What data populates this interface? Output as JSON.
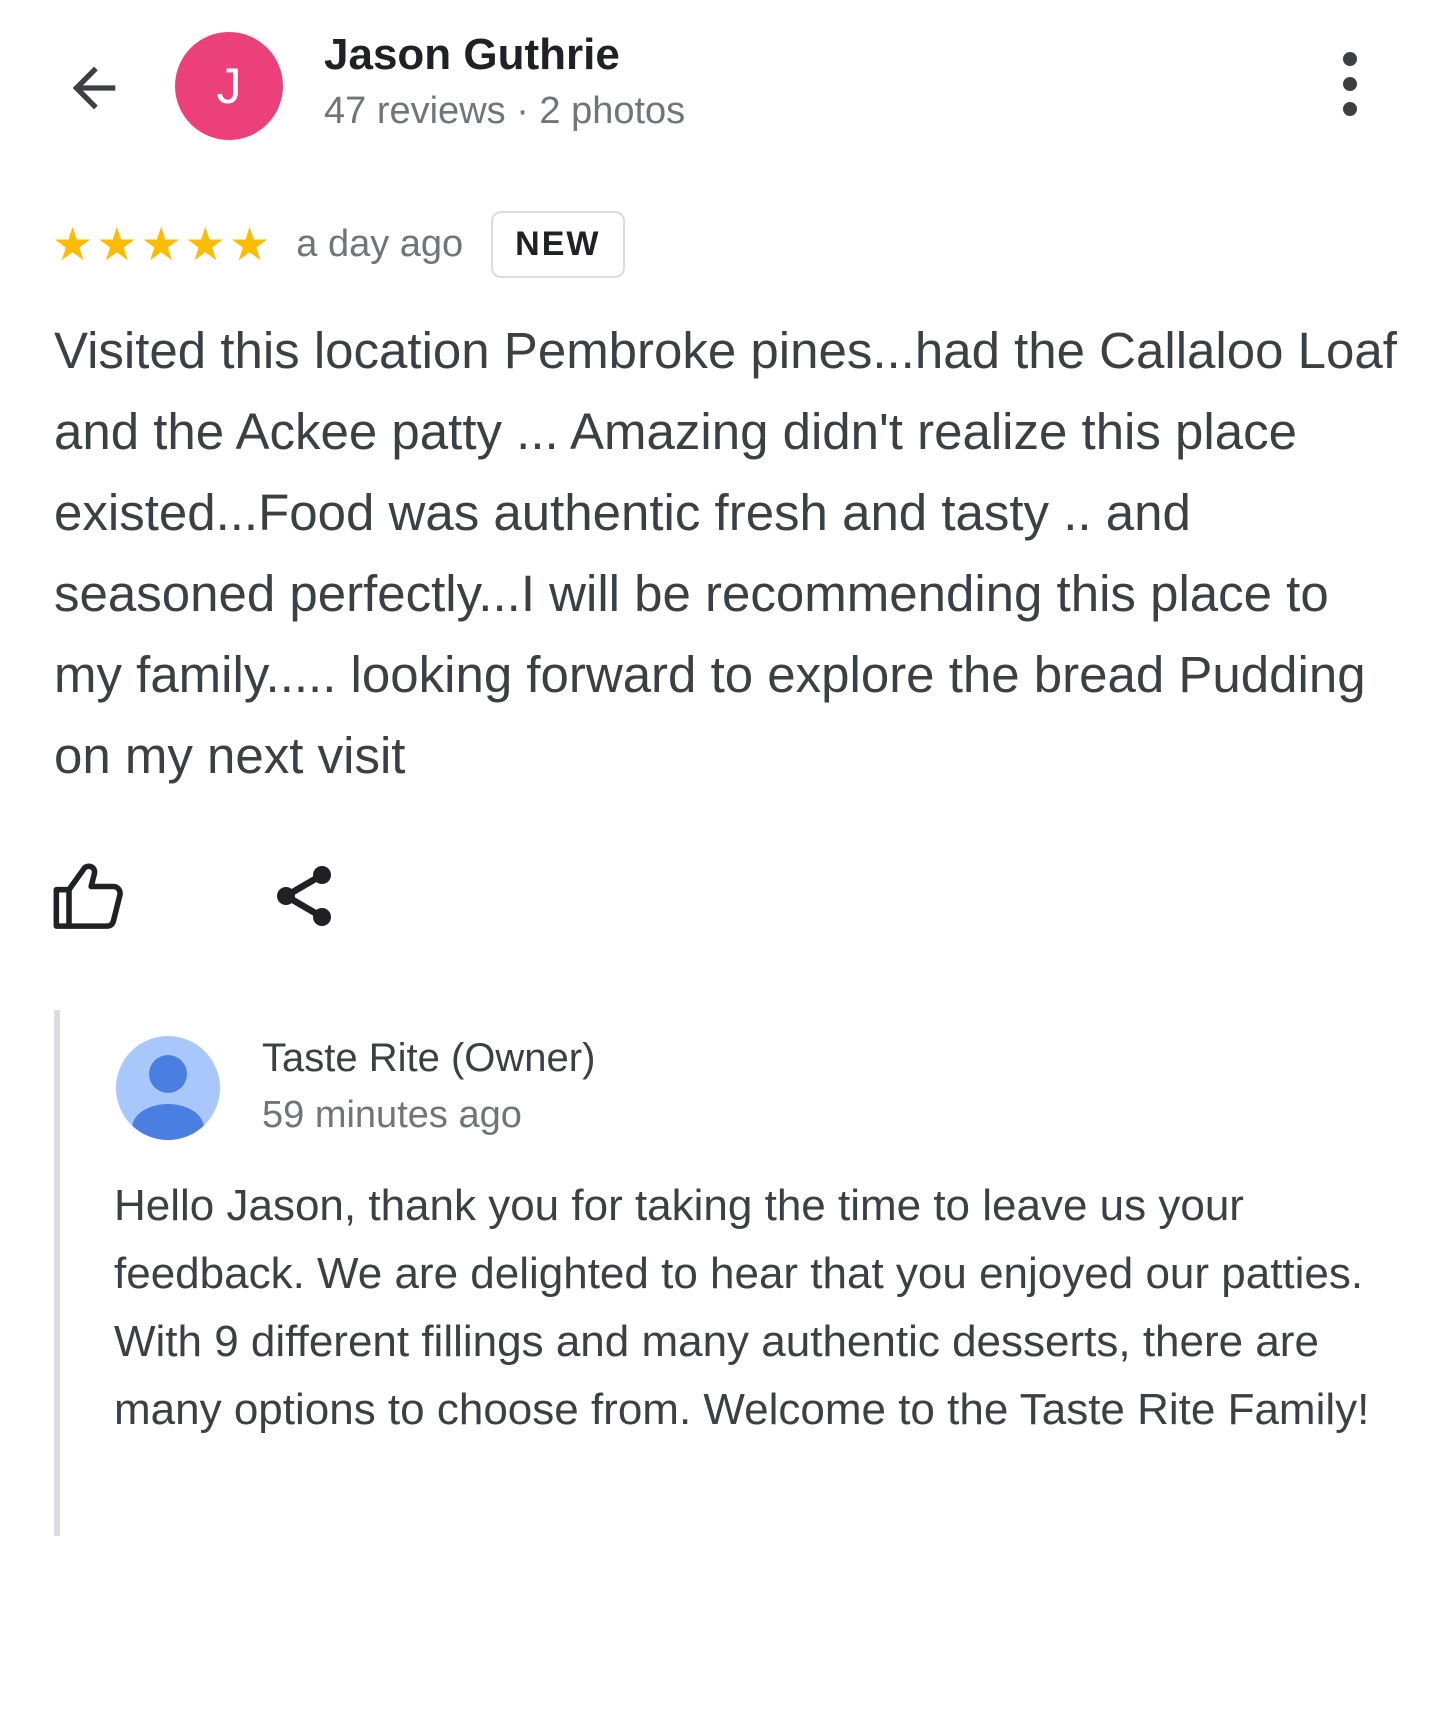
{
  "reviewer": {
    "initial": "J",
    "name": "Jason Guthrie",
    "meta": "47 reviews · 2 photos",
    "avatar_color": "#ec407a"
  },
  "review": {
    "rating": 5,
    "stars": "★★★★★",
    "date": "a day ago",
    "badge": "NEW",
    "text": "Visited this location Pembroke pines...had the Callaloo Loaf and the Ackee patty ... Amazing didn't realize this place existed...Food was authentic fresh and tasty .. and seasoned perfectly...I will be recommending this place to my family..... looking forward to explore the bread Pudding on my next visit"
  },
  "actions": {
    "like_icon": "thumb-up-icon",
    "share_icon": "share-icon"
  },
  "owner_reply": {
    "name": "Taste Rite (Owner)",
    "time": "59 minutes ago",
    "text": "Hello Jason, thank you for taking the time to leave us your feedback. We are delighted to hear that you enjoyed our patties. With 9 different fillings and many authentic desserts, there are many options to choose from. Welcome to the Taste Rite Family!",
    "avatar_color": "#a8c7fa",
    "avatar_figure_color": "#4a7ee0"
  },
  "colors": {
    "star": "#fbbc04",
    "secondary_text": "#70757a",
    "primary_text": "#3c4043"
  }
}
